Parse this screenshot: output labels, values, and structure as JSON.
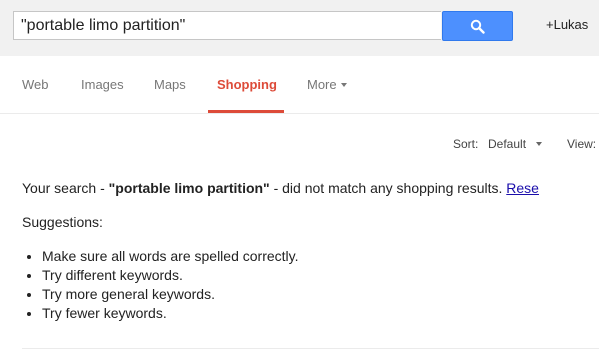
{
  "search": {
    "query": "\"portable limo partition\""
  },
  "header": {
    "user_label": "+Lukas"
  },
  "nav": {
    "tabs": [
      {
        "label": "Web",
        "active": false
      },
      {
        "label": "Images",
        "active": false
      },
      {
        "label": "Maps",
        "active": false
      },
      {
        "label": "Shopping",
        "active": true
      },
      {
        "label": "More",
        "active": false
      }
    ]
  },
  "toolbar": {
    "sort_label": "Sort:",
    "sort_value": "Default",
    "view_label": "View:"
  },
  "result": {
    "prefix": "Your search - ",
    "query": "\"portable limo partition\"",
    "suffix": " - did not match any shopping results. ",
    "link": "Rese"
  },
  "suggestions": {
    "heading": "Suggestions:",
    "items": [
      "Make sure all words are spelled correctly.",
      "Try different keywords.",
      "Try more general keywords.",
      "Try fewer keywords."
    ]
  },
  "colors": {
    "accent": "#4d90fe",
    "active_tab": "#dd4b39",
    "link": "#1a0dab",
    "topbar_bg": "#f1f1f1"
  },
  "icons": {
    "search_button": "search-icon",
    "more_dropdown": "chevron-down-icon",
    "sort_dropdown": "chevron-down-icon"
  }
}
